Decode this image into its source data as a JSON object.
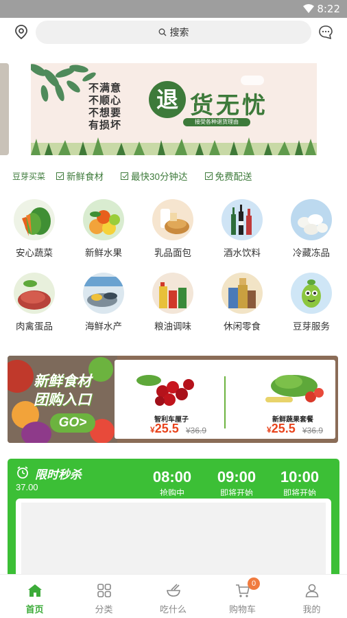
{
  "status_bar": {
    "time": "8:22"
  },
  "header": {
    "search_placeholder": "搜索"
  },
  "banner": {
    "left_lines": [
      "不满意",
      "不顺心",
      "不想要",
      "有损坏"
    ],
    "circle_char": "退",
    "title": "货无忧",
    "subtitle": "接受各种退货理由"
  },
  "features": {
    "brand": "豆芽买菜",
    "items": [
      "新鲜食材",
      "最快30分钟达",
      "免费配送"
    ]
  },
  "categories": [
    {
      "label": "安心蔬菜",
      "color": "#5ea83a"
    },
    {
      "label": "新鲜水果",
      "color": "#f2a33a"
    },
    {
      "label": "乳品面包",
      "color": "#e6c79a"
    },
    {
      "label": "酒水饮料",
      "color": "#7fb3df"
    },
    {
      "label": "冷藏冻品",
      "color": "#9ec8e8"
    },
    {
      "label": "肉禽蛋品",
      "color": "#c9534a"
    },
    {
      "label": "海鲜水产",
      "color": "#8fb4d4"
    },
    {
      "label": "粮油调味",
      "color": "#d98a3a"
    },
    {
      "label": "休闲零食",
      "color": "#e0b56a"
    },
    {
      "label": "豆芽服务",
      "color": "#7bbcea"
    }
  ],
  "promo": {
    "title_line1": "新鲜食材",
    "title_line2": "团购入口",
    "go_label": "GO>",
    "products": [
      {
        "name": "智利车厘子",
        "currency": "¥",
        "price": "25.5",
        "old_price": "¥36.9"
      },
      {
        "name": "新鲜蔬果套餐",
        "currency": "¥",
        "price": "25.5",
        "old_price": "¥36.9"
      }
    ]
  },
  "flash_sale": {
    "title": "限时秒杀",
    "countdown": "37.00",
    "slots": [
      {
        "time": "08:00",
        "status": "抢购中"
      },
      {
        "time": "09:00",
        "status": "即将开始"
      },
      {
        "time": "10:00",
        "status": "即将开始"
      }
    ]
  },
  "tabbar": {
    "tabs": [
      {
        "label": "首页"
      },
      {
        "label": "分类"
      },
      {
        "label": "吃什么"
      },
      {
        "label": "购物车"
      },
      {
        "label": "我的"
      }
    ],
    "cart_badge": "0"
  },
  "colors": {
    "brand_green": "#3cab39",
    "price_red": "#e8431c",
    "status_bar": "#9e9e9e"
  }
}
